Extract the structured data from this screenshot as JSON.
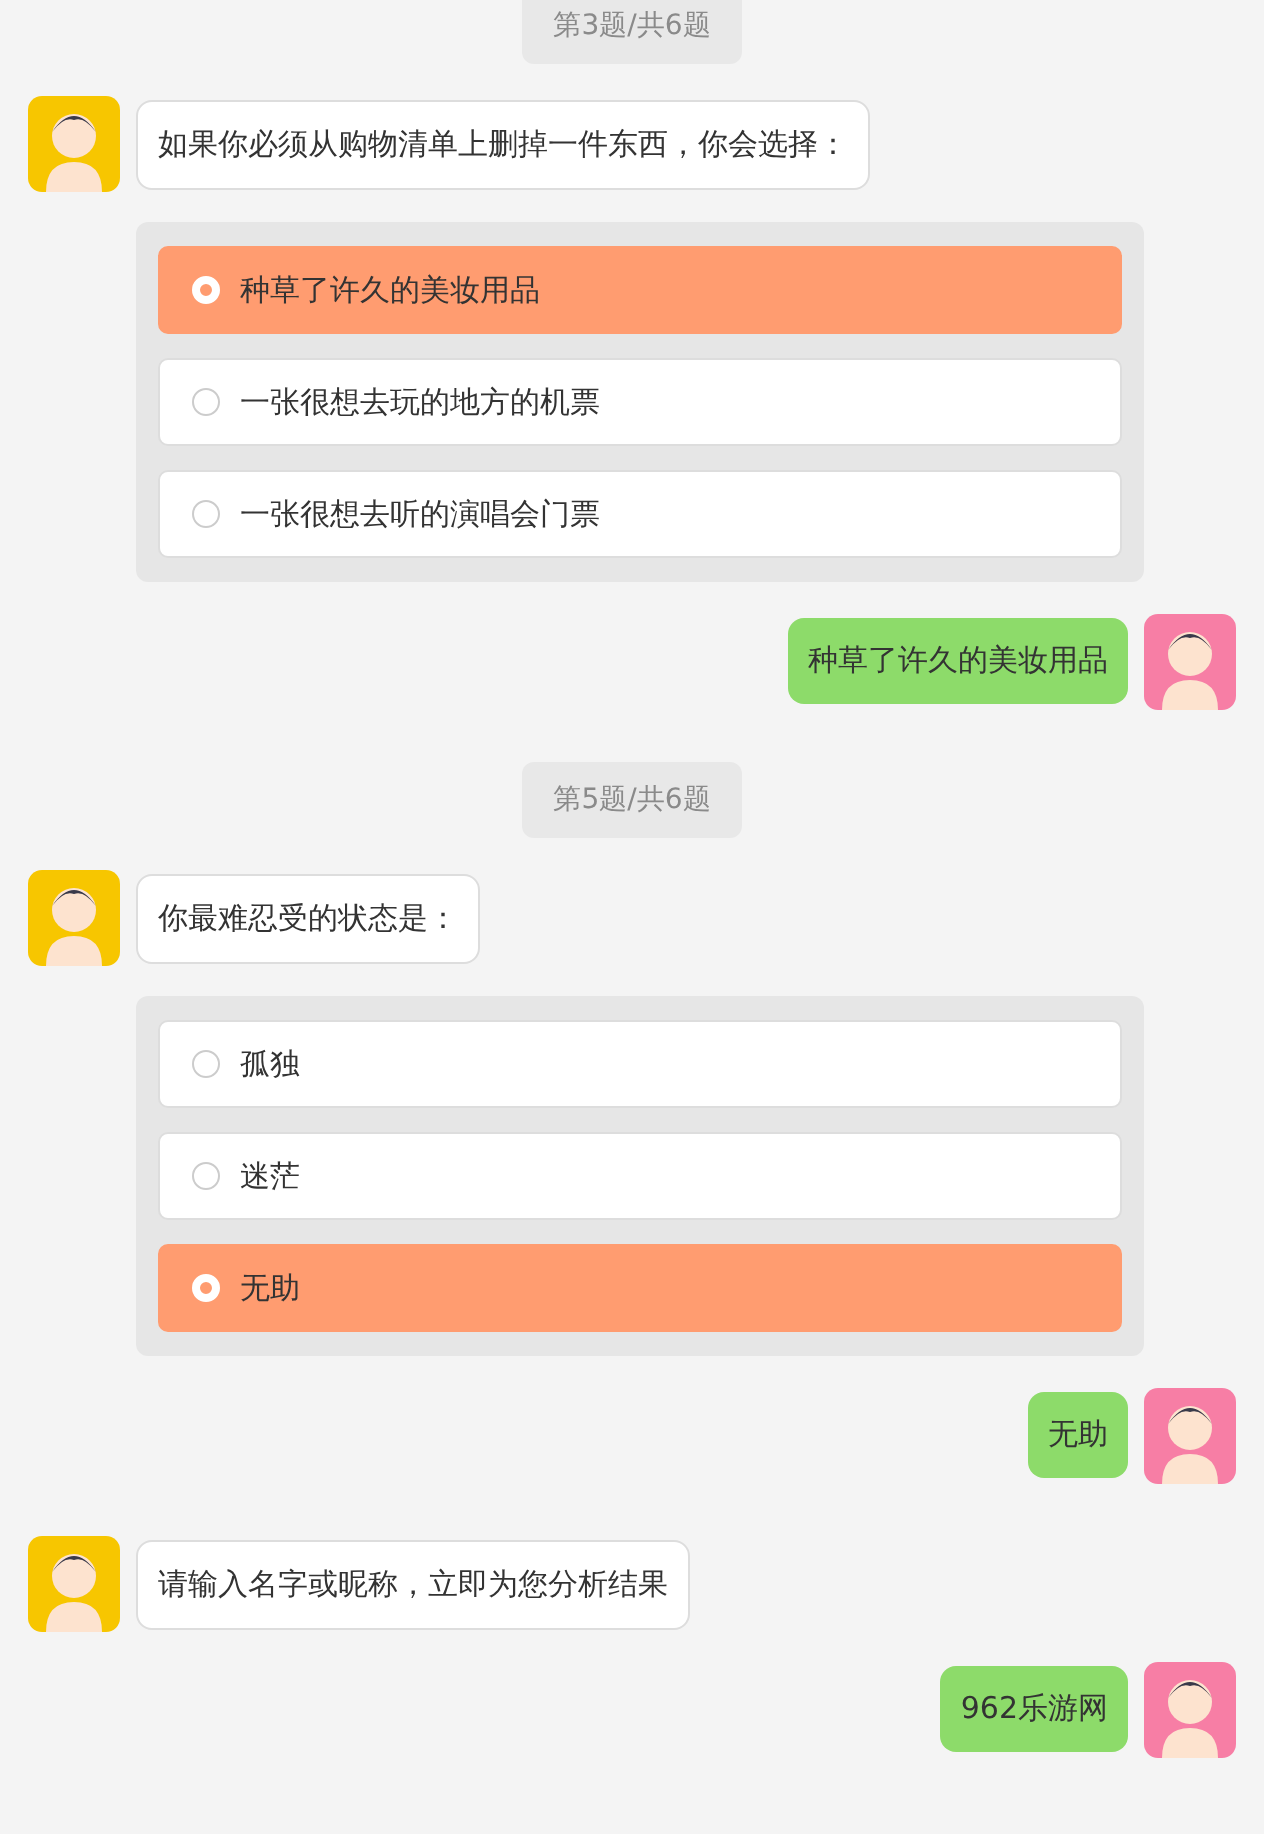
{
  "messages": [
    {
      "kind": "progress",
      "text": "第3题/共6题"
    },
    {
      "kind": "bot",
      "text": "如果你必须从购物清单上删掉一件东西，你会选择："
    },
    {
      "kind": "options",
      "options": [
        {
          "label": "种草了许久的美妆用品",
          "selected": true
        },
        {
          "label": "一张很想去玩的地方的机票",
          "selected": false
        },
        {
          "label": "一张很想去听的演唱会门票",
          "selected": false
        }
      ]
    },
    {
      "kind": "user",
      "text": "种草了许久的美妆用品"
    },
    {
      "kind": "progress",
      "text": "第5题/共6题"
    },
    {
      "kind": "bot",
      "text": "你最难忍受的状态是："
    },
    {
      "kind": "options",
      "options": [
        {
          "label": "孤独",
          "selected": false
        },
        {
          "label": "迷茫",
          "selected": false
        },
        {
          "label": "无助",
          "selected": true
        }
      ]
    },
    {
      "kind": "user",
      "text": "无助"
    },
    {
      "kind": "bot",
      "text": "请输入名字或昵称，立即为您分析结果"
    },
    {
      "kind": "user",
      "text": "962乐游网"
    }
  ]
}
